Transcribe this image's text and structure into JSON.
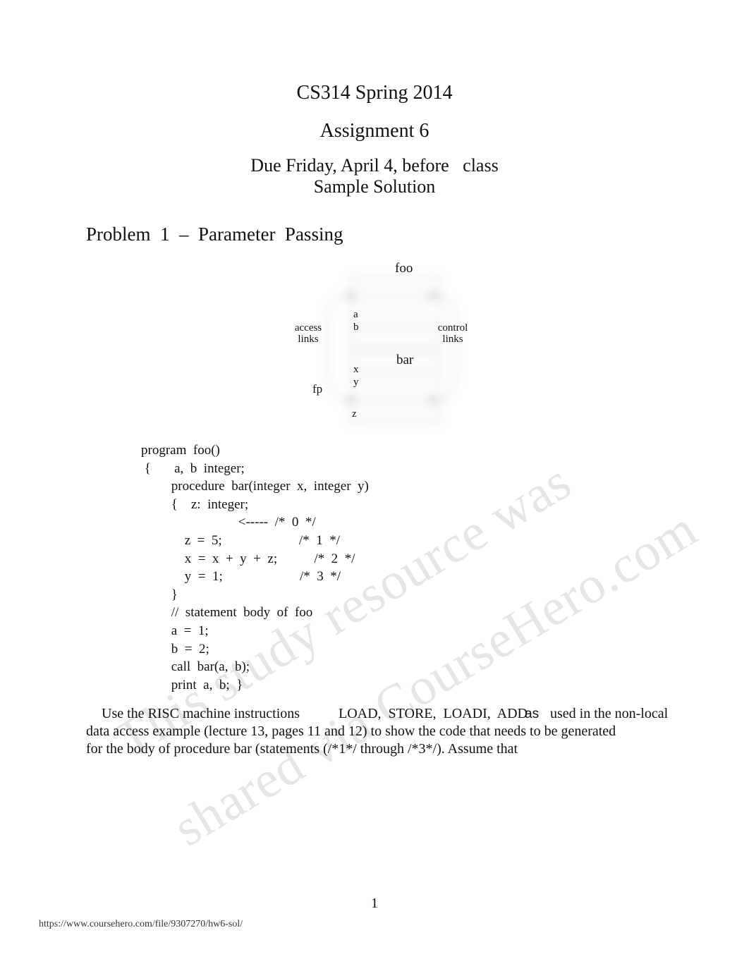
{
  "document": {
    "header": {
      "course_title": "CS314 Spring 2014",
      "assignment_title": "Assignment 6",
      "due_line": "Due Friday, April 4, before   class",
      "sample_line": "Sample Solution"
    },
    "problem_heading": "Problem  1  –  Parameter  Passing",
    "diagram": {
      "labels": {
        "foo": "foo",
        "a": "a",
        "b": "b",
        "access_links": "access\nlinks",
        "control_links": "control\nlinks",
        "bar": "bar",
        "x": "x",
        "y": "y",
        "fp": "fp",
        "z": "z"
      }
    },
    "code_listing": {
      "lines": [
        "program  foo()",
        " {       a,  b  integer;",
        "         procedure  bar(integer  x,  integer  y)",
        "         {    z:  integer;",
        "                             <-----  /*  0  */",
        "             z  =  5;                       /*  1  */",
        "             x  =  x  +  y  +  z;           /*  2  */",
        "             y  =  1;                       /*  3  */",
        "         }",
        "         //  statement  body  of  foo",
        "         a  =  1;",
        "         b  =  2;",
        "         call  bar(a,  b);",
        "         print  a,  b;  }"
      ]
    },
    "paragraph": {
      "line1_a": "Use the RISC machine instructions",
      "line1_b": "LOAD,  STORE,  LOADI,  ADD",
      "line1_overlap": "as",
      "line1_c": "used in the non-local",
      "line2": "data access example (lecture 13, pages 11 and 12) to show the code that needs to be generated",
      "line3": "for the body of procedure bar (statements (/*1*/ through /*3*/). Assume that"
    },
    "watermark": {
      "line1": "This study resource was",
      "line2": "shared via CourseHero.com",
      "color": "#e6e6e6"
    },
    "footer": {
      "page_number": "1",
      "url": "https://www.coursehero.com/file/9307270/hw6-sol/"
    }
  }
}
